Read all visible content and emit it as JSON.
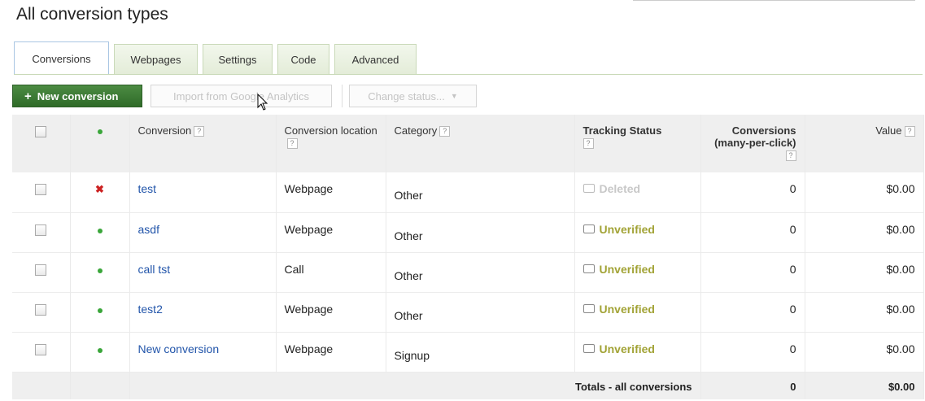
{
  "page": {
    "title": "All conversion types"
  },
  "tabs": [
    {
      "label": "Conversions",
      "active": true
    },
    {
      "label": "Webpages"
    },
    {
      "label": "Settings"
    },
    {
      "label": "Code"
    },
    {
      "label": "Advanced"
    }
  ],
  "toolbar": {
    "new_label": "New conversion",
    "import_label": "Import from Google Analytics",
    "status_label": "Change status..."
  },
  "table": {
    "headers": {
      "conversion": "Conversion",
      "location": "Conversion location",
      "category": "Category",
      "tracking": "Tracking Status",
      "conversions": "Conversions (many-per-click)",
      "value": "Value",
      "help": "?"
    },
    "rows": [
      {
        "status_icon": "x",
        "name": "test",
        "location": "Webpage",
        "category": "Other",
        "tracking": "Deleted",
        "conversions": "0",
        "value": "$0.00"
      },
      {
        "status_icon": "dot",
        "name": "asdf",
        "location": "Webpage",
        "category": "Other",
        "tracking": "Unverified",
        "conversions": "0",
        "value": "$0.00"
      },
      {
        "status_icon": "dot",
        "name": "call tst",
        "location": "Call",
        "category": "Other",
        "tracking": "Unverified",
        "conversions": "0",
        "value": "$0.00"
      },
      {
        "status_icon": "dot",
        "name": "test2",
        "location": "Webpage",
        "category": "Other",
        "tracking": "Unverified",
        "conversions": "0",
        "value": "$0.00"
      },
      {
        "status_icon": "dot",
        "name": "New conversion",
        "location": "Webpage",
        "category": "Signup",
        "tracking": "Unverified",
        "conversions": "0",
        "value": "$0.00"
      }
    ],
    "totals": {
      "label": "Totals - all conversions",
      "conversions": "0",
      "value": "$0.00"
    }
  },
  "colors": {
    "accent": "#2f6b28",
    "link": "#2255aa",
    "unverified": "#a2a336",
    "deleted_icon": "#cc2222",
    "enabled_dot": "#3aa63a"
  }
}
